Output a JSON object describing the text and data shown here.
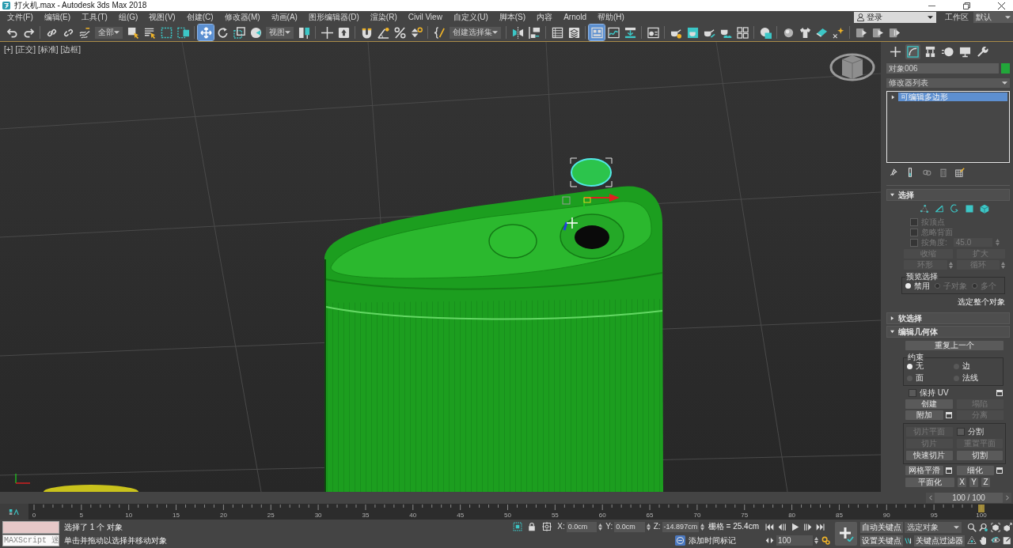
{
  "window": {
    "title": "打火机.max - Autodesk 3ds Max 2018"
  },
  "menu_bar": {
    "items": [
      "文件(F)",
      "编辑(E)",
      "工具(T)",
      "组(G)",
      "视图(V)",
      "创建(C)",
      "修改器(M)",
      "动画(A)",
      "图形编辑器(D)",
      "渲染(R)",
      "Civil View",
      "自定义(U)",
      "脚本(S)",
      "内容",
      "Arnold",
      "帮助(H)"
    ],
    "sign_in": "登录",
    "workspace_label": "工作区",
    "workspace": "默认"
  },
  "toolbar": {
    "items": [
      {
        "kind": "button",
        "selected": false
      },
      {
        "kind": "button",
        "selected": false
      },
      {
        "kind": "button",
        "selected": false
      },
      {
        "kind": "button",
        "selected": false
      },
      {
        "kind": "button",
        "selected": false
      },
      {
        "kind": "dropdown",
        "value": "全部"
      },
      {
        "kind": "button",
        "selected": false
      },
      {
        "kind": "button",
        "selected": false
      },
      {
        "kind": "button",
        "selected": false
      },
      {
        "kind": "button",
        "selected": false
      },
      {
        "kind": "button",
        "selected": true
      },
      {
        "kind": "button",
        "selected": false
      },
      {
        "kind": "button",
        "selected": false
      },
      {
        "kind": "button",
        "selected": false
      },
      {
        "kind": "dropdown",
        "value": "视图"
      },
      {
        "kind": "button",
        "selected": false
      },
      {
        "kind": "button",
        "selected": false
      },
      {
        "kind": "button",
        "selected": false
      },
      {
        "kind": "button",
        "selected": false
      },
      {
        "kind": "button",
        "selected": false
      },
      {
        "kind": "button",
        "selected": false
      },
      {
        "kind": "button",
        "selected": false
      },
      {
        "kind": "button",
        "selected": false
      },
      {
        "kind": "dropdown",
        "value": "创建选择集"
      },
      {
        "kind": "button",
        "selected": false
      },
      {
        "kind": "button",
        "selected": false
      },
      {
        "kind": "button",
        "selected": false
      },
      {
        "kind": "button",
        "selected": false
      },
      {
        "kind": "button",
        "selected": true
      },
      {
        "kind": "button",
        "selected": false
      },
      {
        "kind": "button",
        "selected": false
      },
      {
        "kind": "button",
        "selected": false
      },
      {
        "kind": "button",
        "selected": false
      },
      {
        "kind": "button",
        "selected": false
      },
      {
        "kind": "button",
        "selected": false
      },
      {
        "kind": "button",
        "selected": false
      },
      {
        "kind": "button",
        "selected": false
      },
      {
        "kind": "button",
        "selected": false
      },
      {
        "kind": "button",
        "selected": false
      },
      {
        "kind": "button",
        "selected": false
      },
      {
        "kind": "button",
        "selected": false
      },
      {
        "kind": "button",
        "selected": false
      },
      {
        "kind": "button",
        "selected": false
      },
      {
        "kind": "button",
        "selected": false
      },
      {
        "kind": "button",
        "selected": false
      }
    ]
  },
  "viewport": {
    "labels": [
      "[+]",
      "[正交]",
      "[标准]",
      "[边框]"
    ]
  },
  "command_panel": {
    "tabs": [
      {
        "selected": false
      },
      {
        "selected": true
      },
      {
        "selected": false
      },
      {
        "selected": false
      },
      {
        "selected": false
      },
      {
        "selected": false
      }
    ],
    "object_name": "对象006",
    "modifier_list": "修改器列表",
    "stack": [
      {
        "label": "可编辑多边形",
        "selected": true,
        "expanded": false
      }
    ],
    "selection": {
      "title": "选择",
      "expanded": true,
      "options": [
        {
          "label": "按顶点",
          "checked": false,
          "disabled": true
        },
        {
          "label": "忽略背面",
          "checked": false,
          "disabled": true
        },
        {
          "label": "按角度:",
          "checked": false,
          "disabled": true
        }
      ],
      "angle": "45.0",
      "buttons": [
        {
          "label": "收缩",
          "disabled": true,
          "spinner": false
        },
        {
          "label": "扩大",
          "disabled": true,
          "spinner": false
        },
        {
          "label": "环形",
          "disabled": true,
          "spinner": true
        },
        {
          "label": "循环",
          "disabled": true,
          "spinner": true
        }
      ],
      "preview": {
        "title": "预览选择",
        "options": [
          {
            "label": "禁用",
            "selected": true,
            "disabled": false
          },
          {
            "label": "子对象",
            "selected": false,
            "disabled": true
          },
          {
            "label": "多个",
            "selected": false,
            "disabled": true
          }
        ]
      },
      "info": "选定整个对象"
    },
    "soft_selection": {
      "title": "软选择",
      "expanded": false
    },
    "edit_geometry": {
      "title": "编辑几何体",
      "expanded": true,
      "repeat_last": "重复上一个",
      "constraints": {
        "title": "约束",
        "options": [
          {
            "label": "无",
            "selected": true
          },
          {
            "label": "边",
            "selected": false
          },
          {
            "label": "面",
            "selected": false
          },
          {
            "label": "法线",
            "selected": false
          }
        ]
      },
      "preserve_uv": {
        "label": "保持 UV",
        "checked": false,
        "settings": true
      },
      "buttons": [
        {
          "label": "创建",
          "disabled": false,
          "settings": false
        },
        {
          "label": "塌陷",
          "disabled": true,
          "settings": false
        },
        {
          "label": "附加",
          "disabled": false,
          "settings": true
        },
        {
          "label": "分离",
          "disabled": true,
          "settings": false
        }
      ],
      "slice": [
        {
          "kind": "button",
          "label": "切片平面",
          "disabled": true
        },
        {
          "kind": "checkbox",
          "label": "分割",
          "checked": false
        },
        {
          "kind": "button",
          "label": "切片",
          "disabled": true
        },
        {
          "kind": "button",
          "label": "重置平面",
          "disabled": true
        },
        {
          "kind": "button",
          "label": "快速切片",
          "disabled": false
        },
        {
          "kind": "button",
          "label": "切割",
          "disabled": false
        }
      ],
      "tools": [
        {
          "label": "网格平滑",
          "settings": true
        },
        {
          "label": "细化",
          "settings": true
        }
      ],
      "planarize": {
        "label": "平面化",
        "axes": [
          "X",
          "Y",
          "Z"
        ]
      }
    }
  },
  "time_slider": {
    "label": "100 / 100",
    "level": 1
  },
  "track_bar": {
    "ticks": [
      "0",
      "5",
      "10",
      "15",
      "20",
      "25",
      "30",
      "35",
      "40",
      "45",
      "50",
      "55",
      "60",
      "65",
      "70",
      "75",
      "80",
      "85",
      "90",
      "95",
      "100"
    ]
  },
  "status_bar": {
    "maxscript_input": "MAXScript 迷",
    "prompt": "选择了 1 个 对象",
    "hint": "单击并拖动以选择并移动对象",
    "coordinates": [
      {
        "axis": "X:",
        "value": "0.0cm"
      },
      {
        "axis": "Y:",
        "value": "0.0cm"
      },
      {
        "axis": "Z:",
        "value": "-14.897cm"
      }
    ],
    "grid": "栅格 = 25.4cm",
    "time_tag": "添加时间标记",
    "frame": "100",
    "auto_key": "自动关键点",
    "key_set": "选定对象",
    "set_key": "设置关键点",
    "key_filters": "关键点过滤器"
  }
}
